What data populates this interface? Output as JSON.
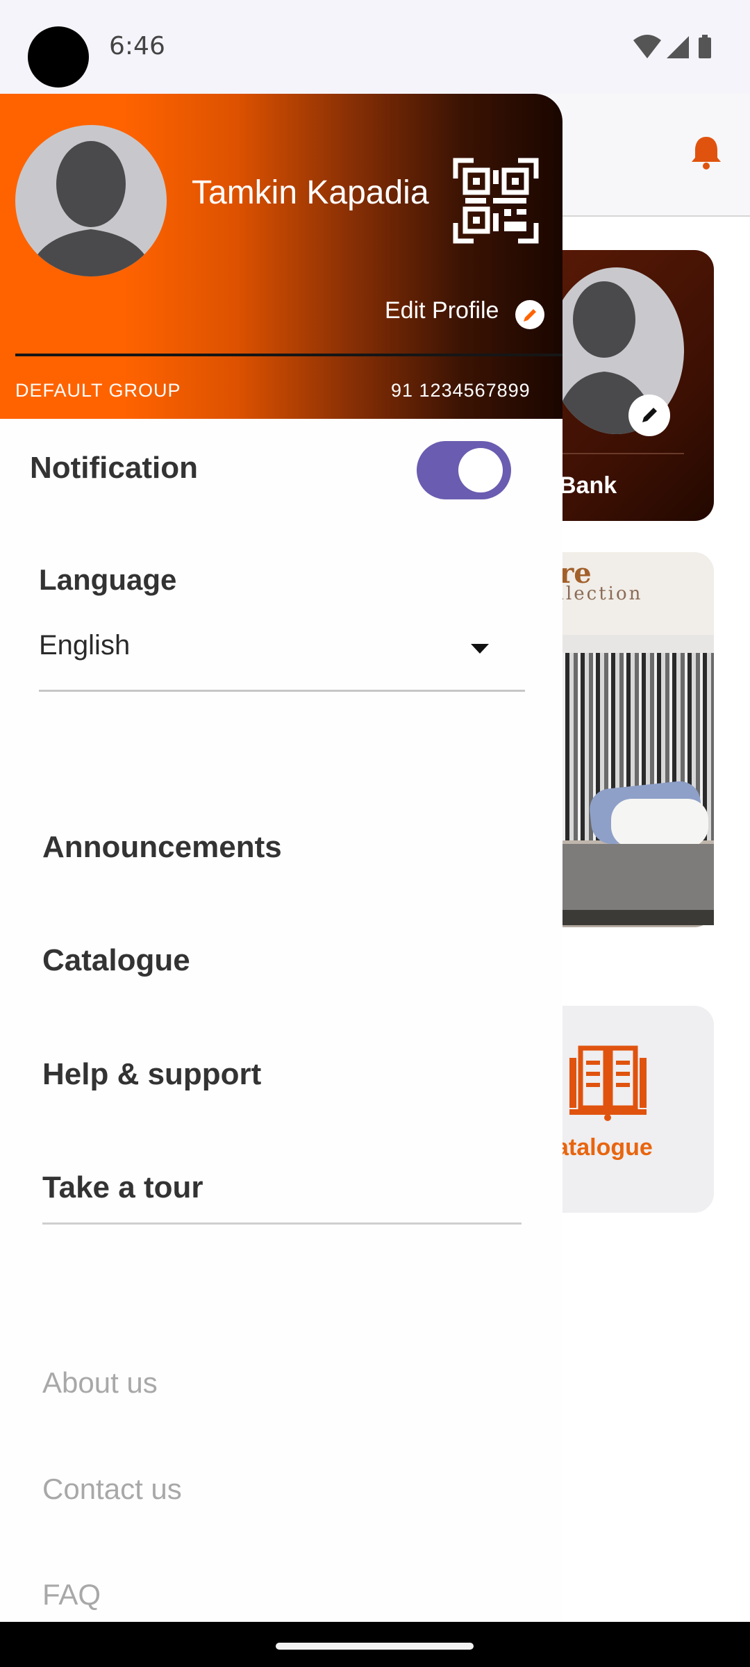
{
  "status_bar": {
    "time": "6:46",
    "icons": [
      "wifi-icon",
      "signal-icon",
      "battery-icon"
    ]
  },
  "drawer": {
    "header": {
      "user_name": "Tamkin Kapadia",
      "edit_profile_label": "Edit Profile",
      "group": "DEFAULT GROUP",
      "phone": "91 1234567899"
    },
    "notification": {
      "label": "Notification",
      "enabled": true
    },
    "language": {
      "label": "Language",
      "selected": "English"
    },
    "menu_items": [
      {
        "label": "Announcements"
      },
      {
        "label": "Catalogue"
      },
      {
        "label": "Help & support"
      },
      {
        "label": "Take a tour"
      }
    ],
    "footer_links": [
      {
        "label": "About us"
      },
      {
        "label": "Contact us"
      },
      {
        "label": "FAQ"
      }
    ]
  },
  "background": {
    "card_label": "Bank",
    "banner_title": "ire",
    "banner_subtitle": "ollection",
    "tile_label": "atalogue"
  },
  "colors": {
    "accent_orange": "#ff6300",
    "header_dark": "#1a0600",
    "toggle_track": "#6a5cb0",
    "bell": "#e8650e"
  }
}
